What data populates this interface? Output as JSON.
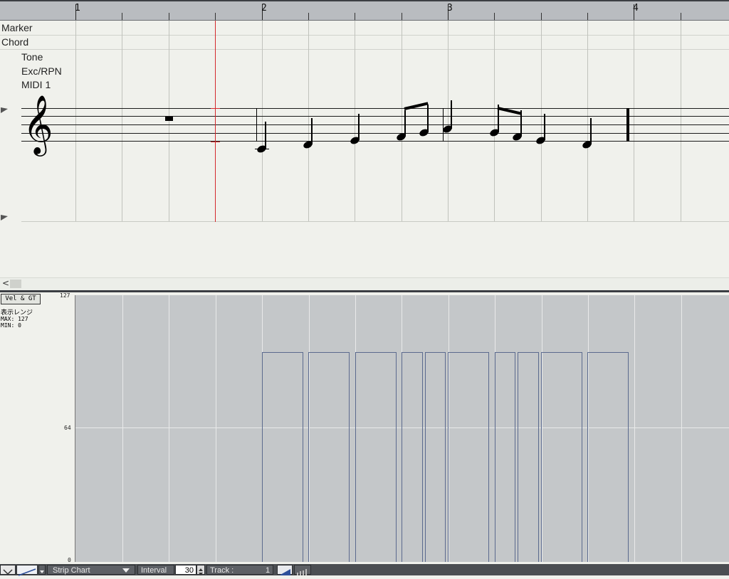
{
  "ruler": {
    "bars": [
      "1",
      "2",
      "3",
      "4"
    ]
  },
  "tracks": {
    "marker": "Marker",
    "chord": "Chord",
    "tone": "Tone",
    "exc_rpn": "Exc/RPN",
    "midi": "MIDI 1"
  },
  "score": {
    "clef": "𝄞"
  },
  "velocity_panel": {
    "mode_button": "Vel & GT",
    "range_label": "表示レンジ",
    "max_label": "MAX: 127",
    "min_label": "MIN:   0",
    "y_ticks": [
      "127",
      "64",
      "0"
    ],
    "y_max": 127,
    "notes_velocity": [
      100,
      100,
      100,
      100,
      100,
      100,
      100,
      100,
      100,
      100
    ]
  },
  "toolbar": {
    "mode": "Strip Chart",
    "interval_label": "Interval",
    "interval_value": "30",
    "track_label": "Track  :",
    "track_value": "1"
  },
  "colors": {
    "playhead": "#d4282c",
    "velocity_bar_outline": "#5b6a8e",
    "velocity_bg": "#c4c7c9"
  }
}
